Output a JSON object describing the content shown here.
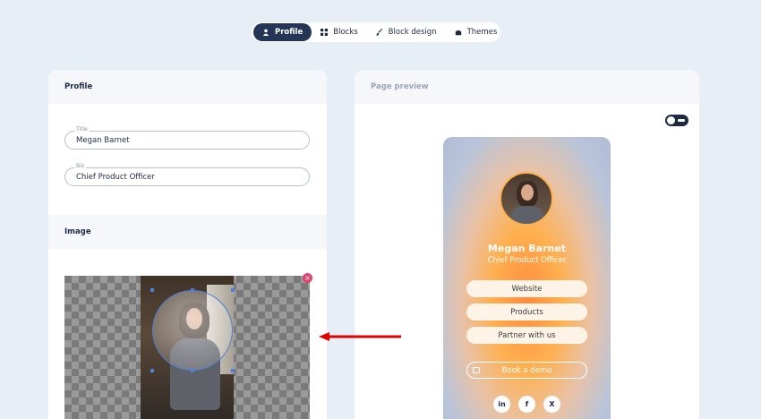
{
  "tabs": [
    {
      "label": "Profile",
      "icon": "user-icon",
      "active": true
    },
    {
      "label": "Blocks",
      "icon": "grid-icon",
      "active": false
    },
    {
      "label": "Block design",
      "icon": "brush-icon",
      "active": false
    },
    {
      "label": "Themes",
      "icon": "palette-icon",
      "active": false
    }
  ],
  "profile_card": {
    "header": "Profile",
    "title_label": "Title",
    "title_value": "Megan Barnet",
    "bio_label": "Bio",
    "bio_value": "Chief Product Officer",
    "image_header": "Image"
  },
  "preview_card": {
    "header": "Page preview",
    "name": "Megan Barnet",
    "bio": "Chief Product Officer",
    "buttons": [
      "Website",
      "Products",
      "Partner with us"
    ],
    "demo_button": "Book a demo",
    "socials": [
      {
        "icon": "linkedin-icon",
        "glyph": "in"
      },
      {
        "icon": "facebook-icon",
        "glyph": "f"
      },
      {
        "icon": "x-icon",
        "glyph": "X"
      }
    ]
  },
  "colors": {
    "accent": "#243556",
    "remove": "#e04372",
    "annotation_arrow": "#e00000"
  }
}
